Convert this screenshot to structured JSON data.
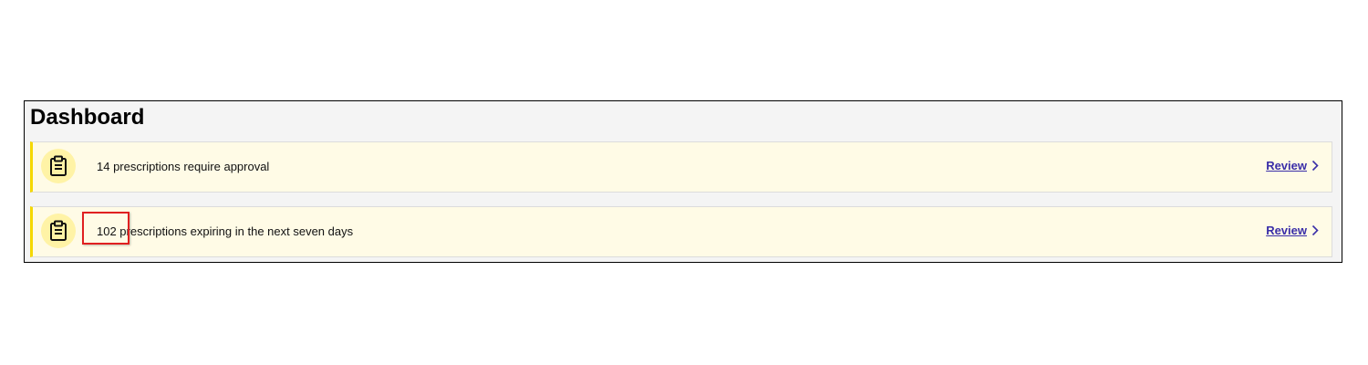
{
  "dashboard": {
    "title": "Dashboard",
    "cards": [
      {
        "icon": "clipboard-icon",
        "message": "14 prescriptions require approval",
        "action_label": "Review"
      },
      {
        "icon": "clipboard-icon",
        "message": "102 prescriptions expiring in the next seven days",
        "action_label": "Review"
      }
    ]
  },
  "colors": {
    "card_background": "#fffbe6",
    "card_accent": "#f5d800",
    "icon_circle": "#fff3a6",
    "link": "#3a2ea8",
    "highlight": "#e02020"
  }
}
